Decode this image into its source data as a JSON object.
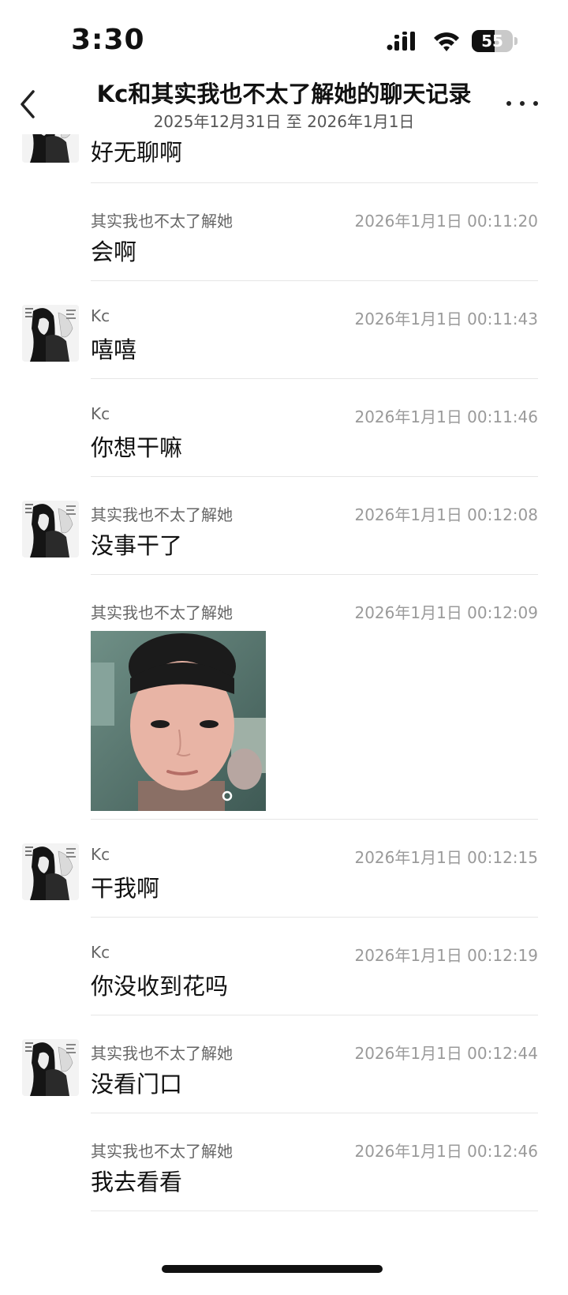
{
  "status_bar": {
    "time": "3:30",
    "battery_level": "55",
    "battery_fraction": 0.55
  },
  "header": {
    "title": "Kc和其实我也不太了解她的聊天记录",
    "date_range": "2025年12月31日 至 2026年1月1日"
  },
  "messages": [
    {
      "sender": "",
      "time": "",
      "text": "好无聊啊",
      "avatar": true,
      "cut": true
    },
    {
      "sender": "其实我也不太了解她",
      "time": "2026年1月1日 00:11:20",
      "text": "会啊",
      "avatar": false
    },
    {
      "sender": "Kc",
      "time": "2026年1月1日 00:11:43",
      "text": "嘻嘻",
      "avatar": true
    },
    {
      "sender": "Kc",
      "time": "2026年1月1日 00:11:46",
      "text": "你想干嘛",
      "avatar": false
    },
    {
      "sender": "其实我也不太了解她",
      "time": "2026年1月1日 00:12:08",
      "text": "没事干了",
      "avatar": true
    },
    {
      "sender": "其实我也不太了解她",
      "time": "2026年1月1日 00:12:09",
      "text": "",
      "image": true,
      "avatar": false
    },
    {
      "sender": "Kc",
      "time": "2026年1月1日 00:12:15",
      "text": "干我啊",
      "avatar": true
    },
    {
      "sender": "Kc",
      "time": "2026年1月1日 00:12:19",
      "text": "你没收到花吗",
      "avatar": false
    },
    {
      "sender": "其实我也不太了解她",
      "time": "2026年1月1日 00:12:44",
      "text": "没看门口",
      "avatar": true
    },
    {
      "sender": "其实我也不太了解她",
      "time": "2026年1月1日 00:12:46",
      "text": "我去看看",
      "avatar": false
    }
  ],
  "icons": {
    "back": "chevron-left-icon",
    "more": "more-dots-icon",
    "signal": "cellular-signal-icon",
    "wifi": "wifi-icon",
    "battery": "battery-icon"
  }
}
